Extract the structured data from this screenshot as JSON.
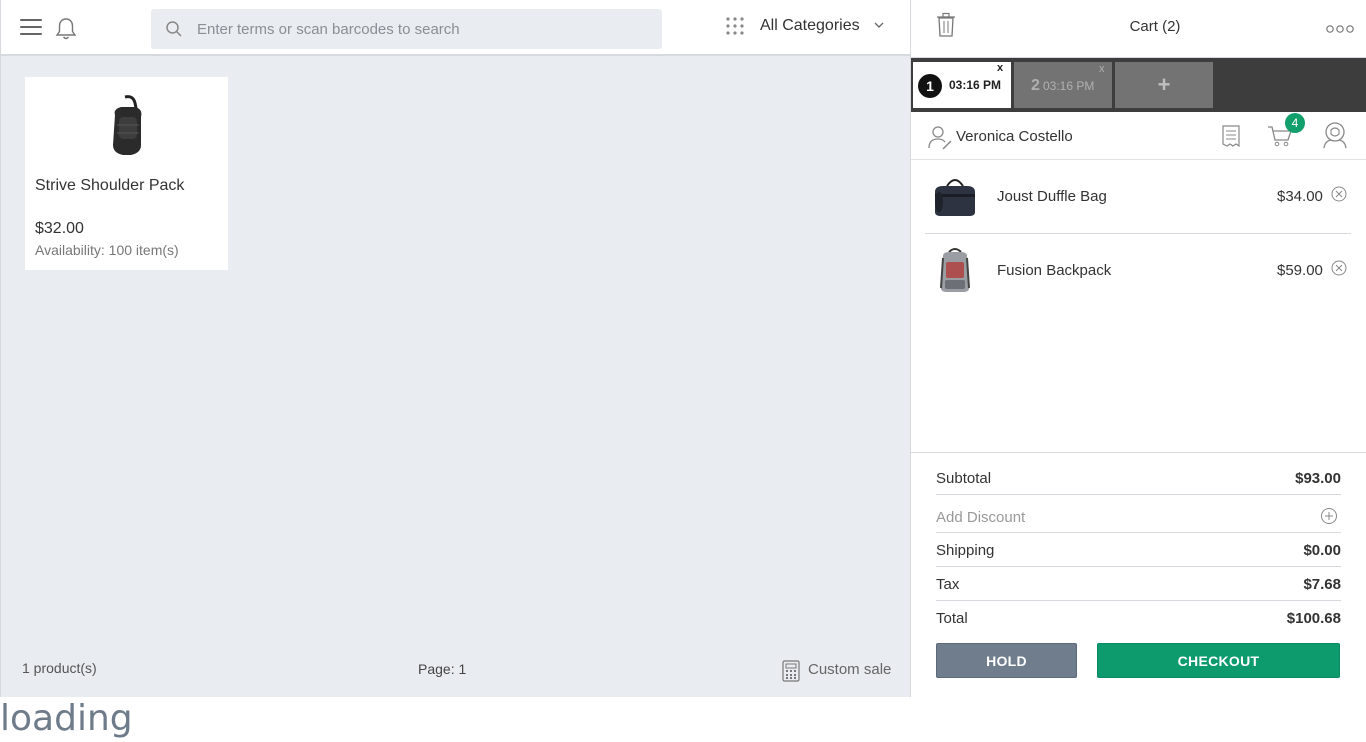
{
  "topbar": {
    "search_placeholder": "Enter terms or scan barcodes to search",
    "category": "All Categories"
  },
  "products": [
    {
      "name": "Strive Shoulder Pack",
      "price": "$32.00",
      "availability": "Availability: 100 item(s)"
    }
  ],
  "footer": {
    "count": "1 product(s)",
    "page": "Page: 1",
    "custom_sale": "Custom sale"
  },
  "cart": {
    "title": "Cart (2)",
    "tabs": [
      {
        "number": "1",
        "time": "03:16 PM",
        "close": "x"
      },
      {
        "number": "2",
        "time": "03:16 PM",
        "close": "x"
      }
    ],
    "add_tab": "+",
    "customer": "Veronica Costello",
    "cart_badge": "4",
    "items": [
      {
        "name": "Joust Duffle Bag",
        "price": "$34.00"
      },
      {
        "name": "Fusion Backpack",
        "price": "$59.00"
      }
    ],
    "totals": {
      "subtotal_label": "Subtotal",
      "subtotal": "$93.00",
      "discount_label": "Add Discount",
      "shipping_label": "Shipping",
      "shipping": "$0.00",
      "tax_label": "Tax",
      "tax": "$7.68",
      "total_label": "Total",
      "total": "$100.68"
    },
    "hold_label": "HOLD",
    "checkout_label": "CHECKOUT"
  },
  "status": "loading",
  "colors": {
    "accent": "#0d9b6d",
    "hold": "#6f7d8c",
    "tabbar": "#3d3d3d",
    "background": "#e9ecf0"
  }
}
